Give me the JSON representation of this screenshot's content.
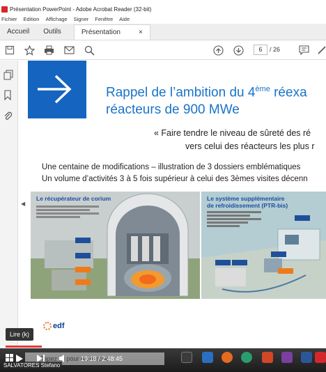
{
  "window": {
    "title": "Présentation PowerPoint - Adobe Acrobat Reader (32-bit)"
  },
  "menu": [
    "Fichier",
    "Edition",
    "Affichage",
    "Signer",
    "Fenêtre",
    "Aide"
  ],
  "tabs": {
    "home": "Accueil",
    "tools": "Outils",
    "document": "Présentation Power...",
    "close": "×"
  },
  "toolbar": {
    "page_current": "6",
    "page_total": "/ 26"
  },
  "slide": {
    "title_line1_a": "Rappel de l’ambition du 4",
    "title_sup": "ème",
    "title_line1_b": " réexa",
    "title_line2": "réacteurs de 900 MWe",
    "quote_line1": "« Faire tendre le niveau de sûreté des ré",
    "quote_line2": "vers celui des réacteurs les plus r",
    "bullet1": "Une centaine de modifications – illustration de 3 dossiers emblématiques",
    "bullet2": "Un volume d’activités 3 à 5 fois supérieur à celui des 3èmes visites décenn",
    "panel_left_title": "Le récupérateur de corium",
    "panel_right_title_1": "Le système supplémentaire",
    "panel_right_title_2": "de refroidissement (PTR-bis)",
    "logo_text": "edf"
  },
  "player": {
    "tooltip": "Lire (k)",
    "time": "19:18 / 2:48:45",
    "progress_fraction": 0.115,
    "search_placeholder": "Tapez ici pour rechercher",
    "presenter": "SALVATORES Stefano"
  },
  "colors": {
    "accent": "#1565c0",
    "title": "#1a73c8",
    "progress": "#e53935",
    "edf_orange": "#f36c21"
  }
}
